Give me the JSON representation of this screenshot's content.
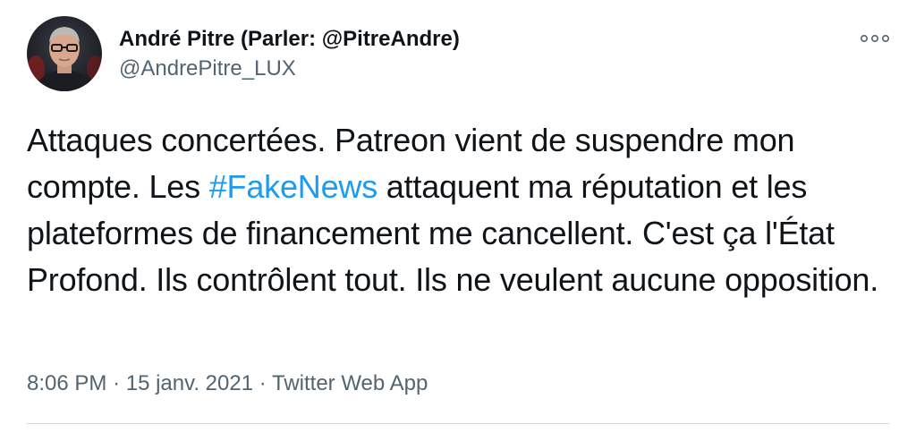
{
  "author": {
    "display_name": "André Pitre (Parler: @PitreAndre)",
    "handle": "@AndrePitre_LUX",
    "avatar_icon": "user-portrait-icon"
  },
  "menu": {
    "more_icon": "more-options-icon"
  },
  "tweet": {
    "text_before": "Attaques concertées.  Patreon vient de suspendre mon compte.  Les ",
    "hashtag": "#FakeNews",
    "text_after": " attaquent ma réputation et les plateformes de financement me cancellent.  C'est ça l'État Profond.  Ils contrôlent tout.  Ils ne veulent aucune opposition."
  },
  "meta": {
    "time": "8:06 PM",
    "separator": "·",
    "date": "15 janv. 2021",
    "source": "Twitter Web App"
  },
  "colors": {
    "text": "#0f1419",
    "secondary": "#536471",
    "link": "#1d9bf0",
    "divider": "#cfd9de"
  }
}
